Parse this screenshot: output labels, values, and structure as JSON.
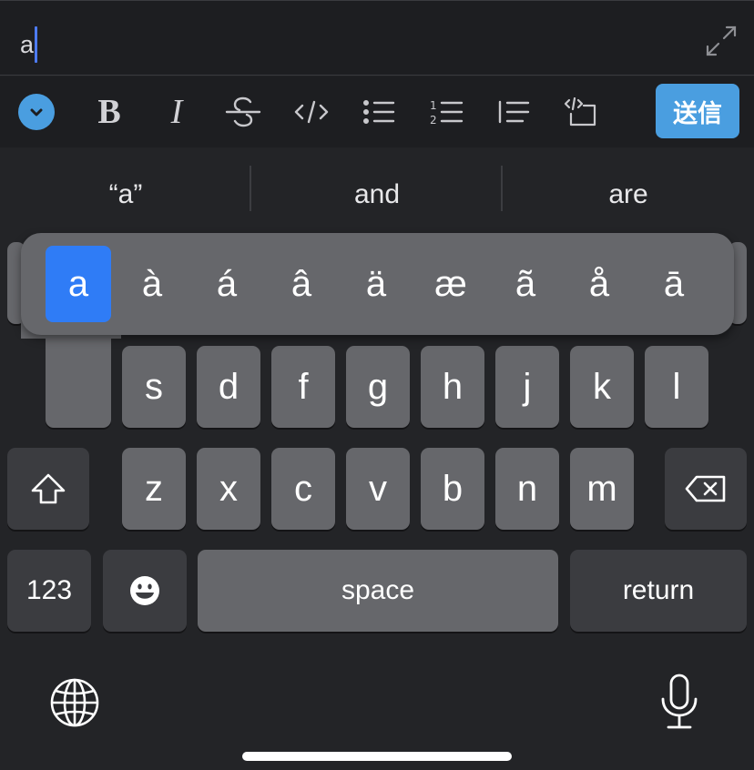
{
  "input": {
    "value": "a"
  },
  "toolbar": {
    "bold_label": "B",
    "italic_label": "I",
    "send_label": "送信"
  },
  "predictions": [
    "“a”",
    "and",
    "are"
  ],
  "accent_popup": {
    "options": [
      "a",
      "à",
      "á",
      "â",
      "ä",
      "æ",
      "ã",
      "å",
      "ā"
    ],
    "selected": "a"
  },
  "keyboard": {
    "row2": [
      "s",
      "d",
      "f",
      "g",
      "h",
      "j",
      "k",
      "l"
    ],
    "row3": [
      "z",
      "x",
      "c",
      "v",
      "b",
      "n",
      "m"
    ],
    "numbers_label": "123",
    "space_label": "space",
    "return_label": "return"
  },
  "colors": {
    "accent": "#4a9ee0",
    "selected_key": "#2f7cf6",
    "caret": "#4d7bf5",
    "key": "#66676b",
    "key_dark": "#3b3c40"
  },
  "icons": [
    "expand-icon",
    "chevron-down-icon",
    "strikethrough-icon",
    "code-icon",
    "bullet-list-icon",
    "numbered-list-icon",
    "quote-icon",
    "code-block-icon",
    "shift-icon",
    "delete-icon",
    "emoji-icon",
    "globe-icon",
    "microphone-icon"
  ]
}
